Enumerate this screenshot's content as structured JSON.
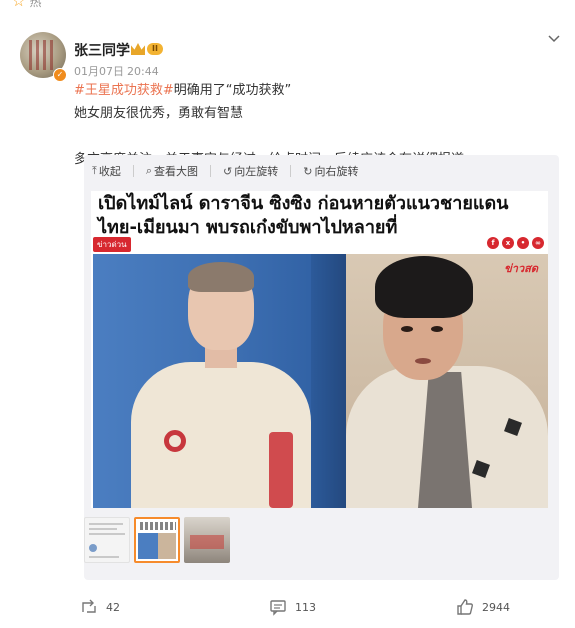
{
  "hot_label": "热",
  "post": {
    "username": "张三同学",
    "level": "II",
    "timestamp_date": "01月07日",
    "timestamp_time": "20:44",
    "hashtag": "#王星成功获救#",
    "line1_suffix": "明确用了“成功获救”",
    "line2": "她女朋友很优秀，勇敢有智慧",
    "line3": "多方高度关注，关于事实与经过，给点时间，后续应该会有详细报道。"
  },
  "toolbar": {
    "collapse": "收起",
    "view_large": "查看大图",
    "rotate_left": "向左旋转",
    "rotate_right": "向右旋转"
  },
  "article_image": {
    "headline": "เปิดไทม์ไลน์ ดาราจีน ซิงซิง ก่อนหายตัวแนวชายแดนไทย-เมียนมา พบรถเก๋งขับพาไปหลายที่",
    "tag": "ข่าวด่วน",
    "logo_text": "ข่าวสด"
  },
  "actions": {
    "repost_count": "42",
    "comment_count": "113",
    "like_count": "2944"
  },
  "colors": {
    "hashtag": "#eb7350",
    "tag_red": "#d7282f",
    "thumb_selected_border": "#f68b2c"
  }
}
